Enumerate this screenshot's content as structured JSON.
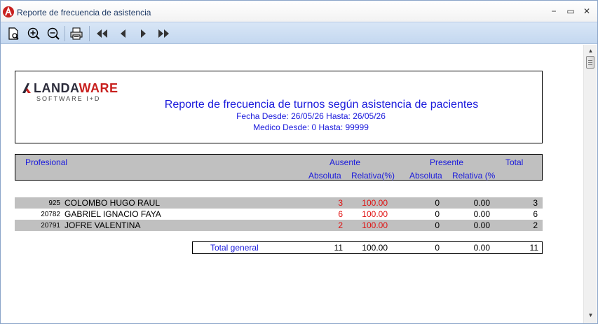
{
  "window": {
    "title": "Reporte de frecuencia de asistencia",
    "minimize": "−",
    "maximize": "▭",
    "close": "✕"
  },
  "toolbar": {
    "buttons": [
      "page-preview-icon",
      "zoom-in-icon",
      "zoom-out-icon",
      "print-icon",
      "first-page-icon",
      "previous-page-icon",
      "next-page-icon",
      "last-page-icon"
    ]
  },
  "logo": {
    "brand_part1": "LANDA",
    "brand_part2": "WARE",
    "tagline": "SOFTWARE I+D",
    "accent_color": "#c8201e"
  },
  "report": {
    "title": "Reporte de frecuencia de turnos según asistencia de pacientes",
    "date_range": "Fecha Desde: 26/05/26 Hasta: 26/05/26",
    "medico_range": "Medico Desde: 0 Hasta: 99999"
  },
  "columns": {
    "profesional": "Profesional",
    "ausente": "Ausente",
    "presente": "Presente",
    "total": "Total",
    "ausente_abs": "Absoluta",
    "ausente_rel": "Relativa(%)",
    "presente_abs": "Absoluta",
    "presente_rel": "Relativa (%"
  },
  "rows": [
    {
      "code": "925",
      "name": "COLOMBO HUGO RAUL",
      "aus_abs": "3",
      "aus_rel": "100.00",
      "pres_abs": "0",
      "pres_rel": "0.00",
      "total": "3"
    },
    {
      "code": "20782",
      "name": "GABRIEL IGNACIO FAYA",
      "aus_abs": "6",
      "aus_rel": "100.00",
      "pres_abs": "0",
      "pres_rel": "0.00",
      "total": "6"
    },
    {
      "code": "20791",
      "name": "JOFRE VALENTINA",
      "aus_abs": "2",
      "aus_rel": "100.00",
      "pres_abs": "0",
      "pres_rel": "0.00",
      "total": "2"
    }
  ],
  "totals": {
    "label": "Total general",
    "aus_abs": "11",
    "aus_rel": "100.00",
    "pres_abs": "0",
    "pres_rel": "0.00",
    "total": "11"
  },
  "colors": {
    "heading_blue": "#1a1adc",
    "absent_red": "#e01010",
    "row_shade": "#c0c0c0"
  }
}
